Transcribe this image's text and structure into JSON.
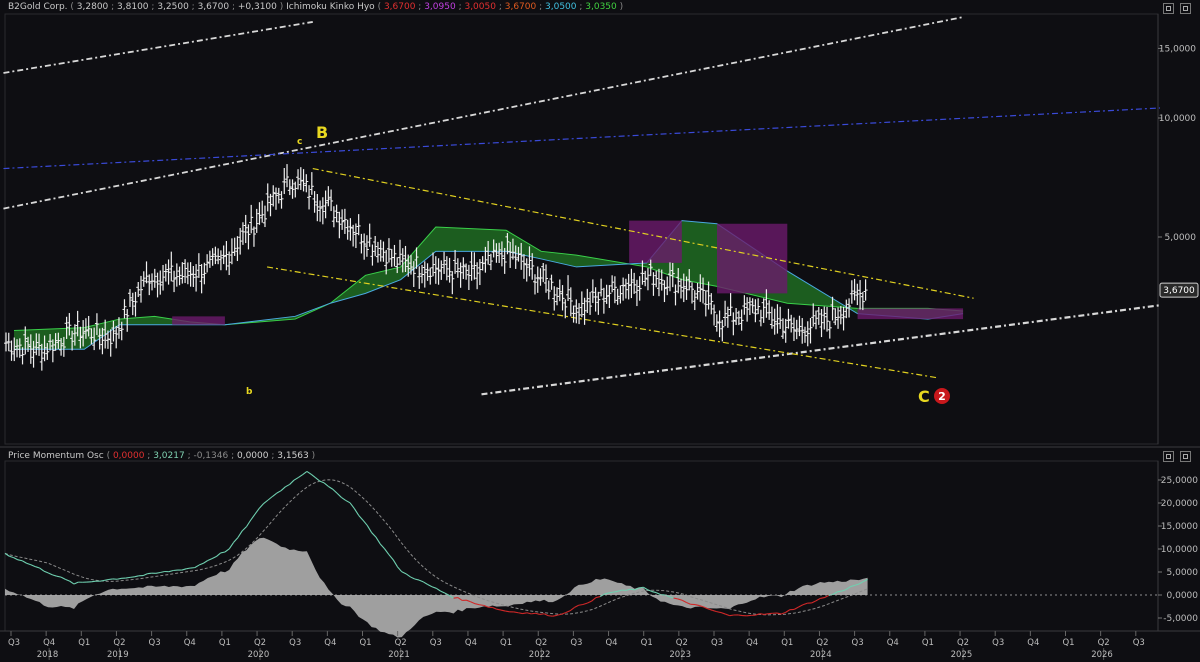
{
  "header_main": {
    "symbol": "B2Gold Corp.",
    "ohlc": [
      "3,2800",
      "3,8100",
      "3,2500",
      "3,6700",
      "+0,3100"
    ],
    "indicator": "Ichimoku Kinko Hyo",
    "indicator_values": [
      {
        "v": "3,6700",
        "color": "#e03030"
      },
      {
        "v": "3,0950",
        "color": "#c040e0"
      },
      {
        "v": "3,0050",
        "color": "#e03030"
      },
      {
        "v": "3,6700",
        "color": "#e05a20"
      },
      {
        "v": "3,0500",
        "color": "#40c0e0"
      },
      {
        "v": "3,0350",
        "color": "#40d040"
      }
    ]
  },
  "header_osc": {
    "indicator": "Price Momentum Osc",
    "values": [
      {
        "v": "0,0000",
        "color": "#e03030"
      },
      {
        "v": "3,0217",
        "color": "#7fd0b0"
      },
      {
        "v": "-0,1346",
        "color": "#8a8a8a"
      },
      {
        "v": "0,0000",
        "color": "#d0d0d0"
      },
      {
        "v": "3,1563",
        "color": "#d0d0d0"
      }
    ]
  },
  "price_axis": {
    "ticks": [
      "15,0000",
      "10,0000",
      "5,0000"
    ],
    "current_price": "3,6700"
  },
  "osc_axis": {
    "ticks": [
      "25,0000",
      "20,0000",
      "15,0000",
      "10,0000",
      "5,0000",
      "0,0000",
      "-5,0000"
    ]
  },
  "time_axis": {
    "quarters": [
      "Q3",
      "Q4",
      "Q1",
      "Q2",
      "Q3",
      "Q4",
      "Q1",
      "Q2",
      "Q3",
      "Q4",
      "Q1",
      "Q2",
      "Q3",
      "Q4",
      "Q1",
      "Q2",
      "Q3",
      "Q4",
      "Q1",
      "Q2",
      "Q3",
      "Q4",
      "Q1",
      "Q2",
      "Q3",
      "Q4",
      "Q1",
      "Q2",
      "Q3",
      "Q4",
      "Q1",
      "Q2",
      "Q3"
    ],
    "years": [
      "2018",
      "2019",
      "2020",
      "2021",
      "2022",
      "2023",
      "2024",
      "2025",
      "2026"
    ]
  },
  "annotations": {
    "wave_B": "B",
    "wave_c": "c",
    "wave_b": "b",
    "wave_C": "C",
    "circle_num": "2"
  },
  "colors": {
    "ichimoku_bull": "#1f6b22",
    "ichimoku_bear": "#6b1a6b",
    "channel_yellow": "#e0d020",
    "trend_white": "#d8d8d8",
    "trend_blue": "#3a4ad8"
  },
  "chart_data": {
    "type": "line",
    "title": "B2Gold Corp.",
    "x_range": [
      "2018-Q3",
      "2026-Q3"
    ],
    "y_scale": "log",
    "ylim": [
      2.6,
      18
    ],
    "weekly_close_approx": [
      {
        "x": "2018-Q3",
        "y": 2.7
      },
      {
        "x": "2018-Q4",
        "y": 2.6
      },
      {
        "x": "2019-Q1",
        "y": 2.9
      },
      {
        "x": "2019-Q2",
        "y": 2.8
      },
      {
        "x": "2019-Q3",
        "y": 4.0
      },
      {
        "x": "2019-Q4",
        "y": 4.0
      },
      {
        "x": "2020-Q1",
        "y": 4.3
      },
      {
        "x": "2020-Q2",
        "y": 5.5
      },
      {
        "x": "2020-Q3",
        "y": 7.0
      },
      {
        "x": "2020-Q4",
        "y": 6.0
      },
      {
        "x": "2021-Q1",
        "y": 5.0
      },
      {
        "x": "2021-Q2",
        "y": 4.3
      },
      {
        "x": "2021-Q3",
        "y": 4.2
      },
      {
        "x": "2021-Q4",
        "y": 4.0
      },
      {
        "x": "2022-Q1",
        "y": 4.6
      },
      {
        "x": "2022-Q2",
        "y": 3.9
      },
      {
        "x": "2022-Q3",
        "y": 3.3
      },
      {
        "x": "2022-Q4",
        "y": 3.7
      },
      {
        "x": "2023-Q1",
        "y": 4.0
      },
      {
        "x": "2023-Q2",
        "y": 3.8
      },
      {
        "x": "2023-Q3",
        "y": 3.1
      },
      {
        "x": "2023-Q4",
        "y": 3.3
      },
      {
        "x": "2024-Q1",
        "y": 2.9
      },
      {
        "x": "2024-Q2",
        "y": 3.1
      },
      {
        "x": "2024-Q3",
        "y": 3.67
      }
    ],
    "last_price": 3.67,
    "legend": "top-left"
  }
}
